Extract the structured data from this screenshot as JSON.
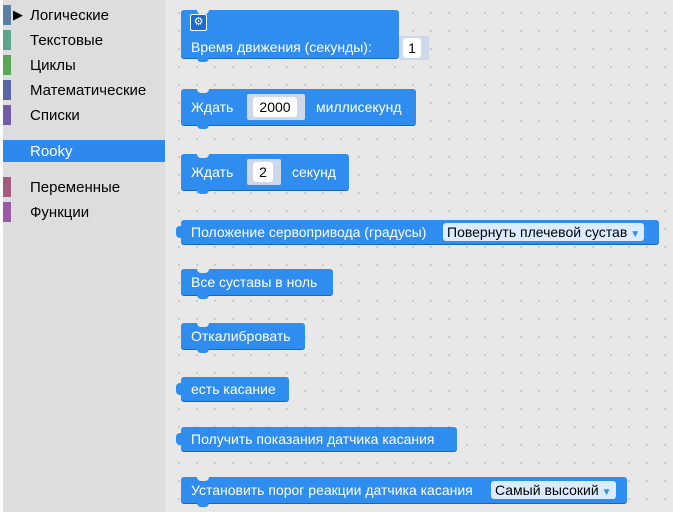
{
  "toolbox": {
    "categories": [
      {
        "label": "Логические",
        "color": "#5b80a5",
        "expanded_arrow": "▶"
      },
      {
        "label": "Текстовые",
        "color": "#5ba58c"
      },
      {
        "label": "Циклы",
        "color": "#5ba55b"
      },
      {
        "label": "Математические",
        "color": "#5b67a5"
      },
      {
        "label": "Списки",
        "color": "#745ba5"
      },
      {
        "label": "Rooky",
        "color": "#2f88ee",
        "selected": true
      },
      {
        "label": "Переменные",
        "color": "#a55b80"
      },
      {
        "label": "Функции",
        "color": "#995ba5"
      }
    ]
  },
  "blocks": {
    "movement_time": {
      "label": "Время движения (секунды):",
      "value": "1",
      "icon": "gear-icon"
    },
    "wait_ms": {
      "prefix": "Ждать",
      "value": "2000",
      "suffix": "миллисекунд"
    },
    "wait_s": {
      "prefix": "Ждать",
      "value": "2",
      "suffix": "секунд"
    },
    "servo_position": {
      "label": "Положение сервопривода (градусы)",
      "dropdown": "Повернуть плечевой сустав"
    },
    "all_joints_zero": {
      "label": "Все суставы в ноль"
    },
    "calibrate": {
      "label": "Откалибровать"
    },
    "touch_detected": {
      "label": "есть касание"
    },
    "touch_sensor_reading": {
      "label": "Получить показания датчика касания"
    },
    "touch_threshold": {
      "label": "Установить порог реакции датчика касания",
      "dropdown": "Самый высокий"
    }
  },
  "colors": {
    "block": "#2f8df0",
    "selected_category": "#2f88ee",
    "workspace": "#e8e8e8",
    "toolbox": "#dddddd"
  }
}
